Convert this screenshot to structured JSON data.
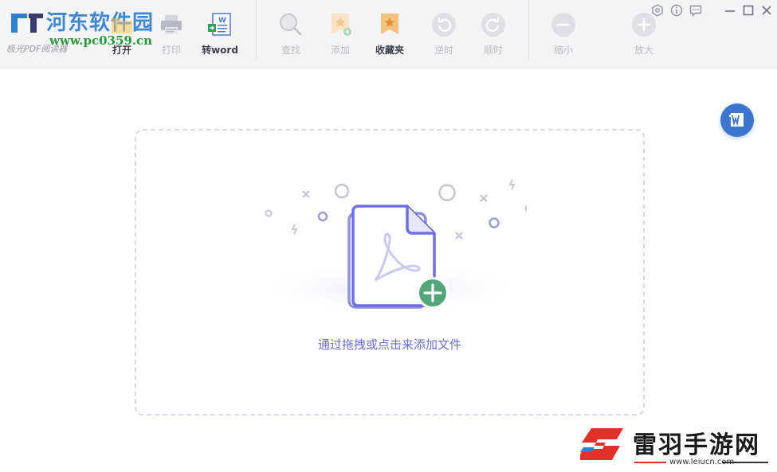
{
  "app": {
    "caption": "极光PDF阅读器"
  },
  "watermark": {
    "title": "河东软件园",
    "url": "www.pc0359.cn"
  },
  "toolbar": {
    "open": "打开",
    "print": "打印",
    "to_word": "转word",
    "find": "查找",
    "add": "添加",
    "favorites": "收藏夹",
    "rotate_ccw": "逆时",
    "rotate_cw": "顺时",
    "zoom_out": "缩小",
    "zoom_in": "放大"
  },
  "drop_zone": {
    "hint": "通过拖拽或点击来添加文件"
  },
  "watermark2": {
    "title": "雷羽手游网",
    "url": "www.leiucn.com"
  },
  "colors": {
    "accent": "#6a6fd1",
    "toolbar_bg": "#f4f4f6",
    "float_button": "#3d76cf",
    "add_badge": "#52a77a"
  }
}
